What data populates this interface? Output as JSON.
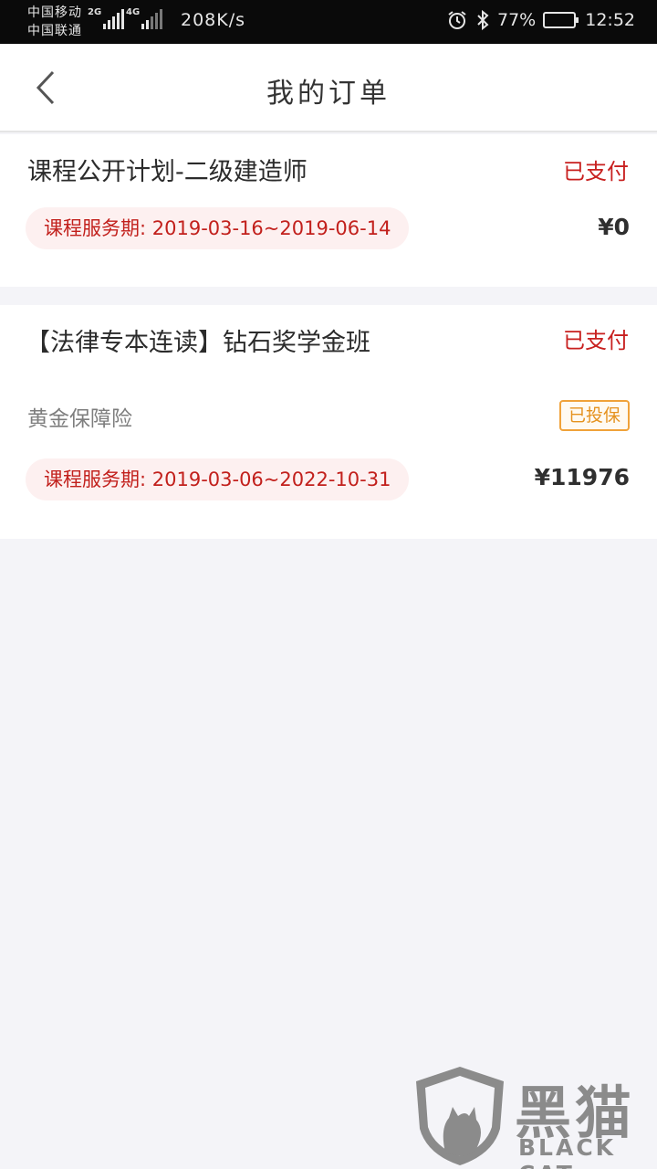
{
  "status_bar": {
    "carrier_1": "中国移动",
    "carrier_2": "中国联通",
    "network_1": "2G",
    "network_2": "4G",
    "speed": "208K/s",
    "battery": "77%",
    "time": "12:52"
  },
  "header": {
    "title": "我的订单"
  },
  "orders": [
    {
      "title": "课程公开计划-二级建造师",
      "status": "已支付",
      "period": "课程服务期: 2019-03-16~2019-06-14",
      "price": "¥0"
    },
    {
      "title": "【法律专本连读】钻石奖学金班",
      "status": "已支付",
      "insurance": "黄金保障险",
      "insurance_status": "已投保",
      "period": "课程服务期: 2019-03-06~2022-10-31",
      "price": "¥11976"
    }
  ],
  "watermark": {
    "chinese": "黑猫",
    "latin": "BLACK CAT"
  },
  "colors": {
    "accent_red": "#c8201f",
    "pill_bg": "#fdf0f0",
    "badge_orange": "#f0a23a"
  }
}
